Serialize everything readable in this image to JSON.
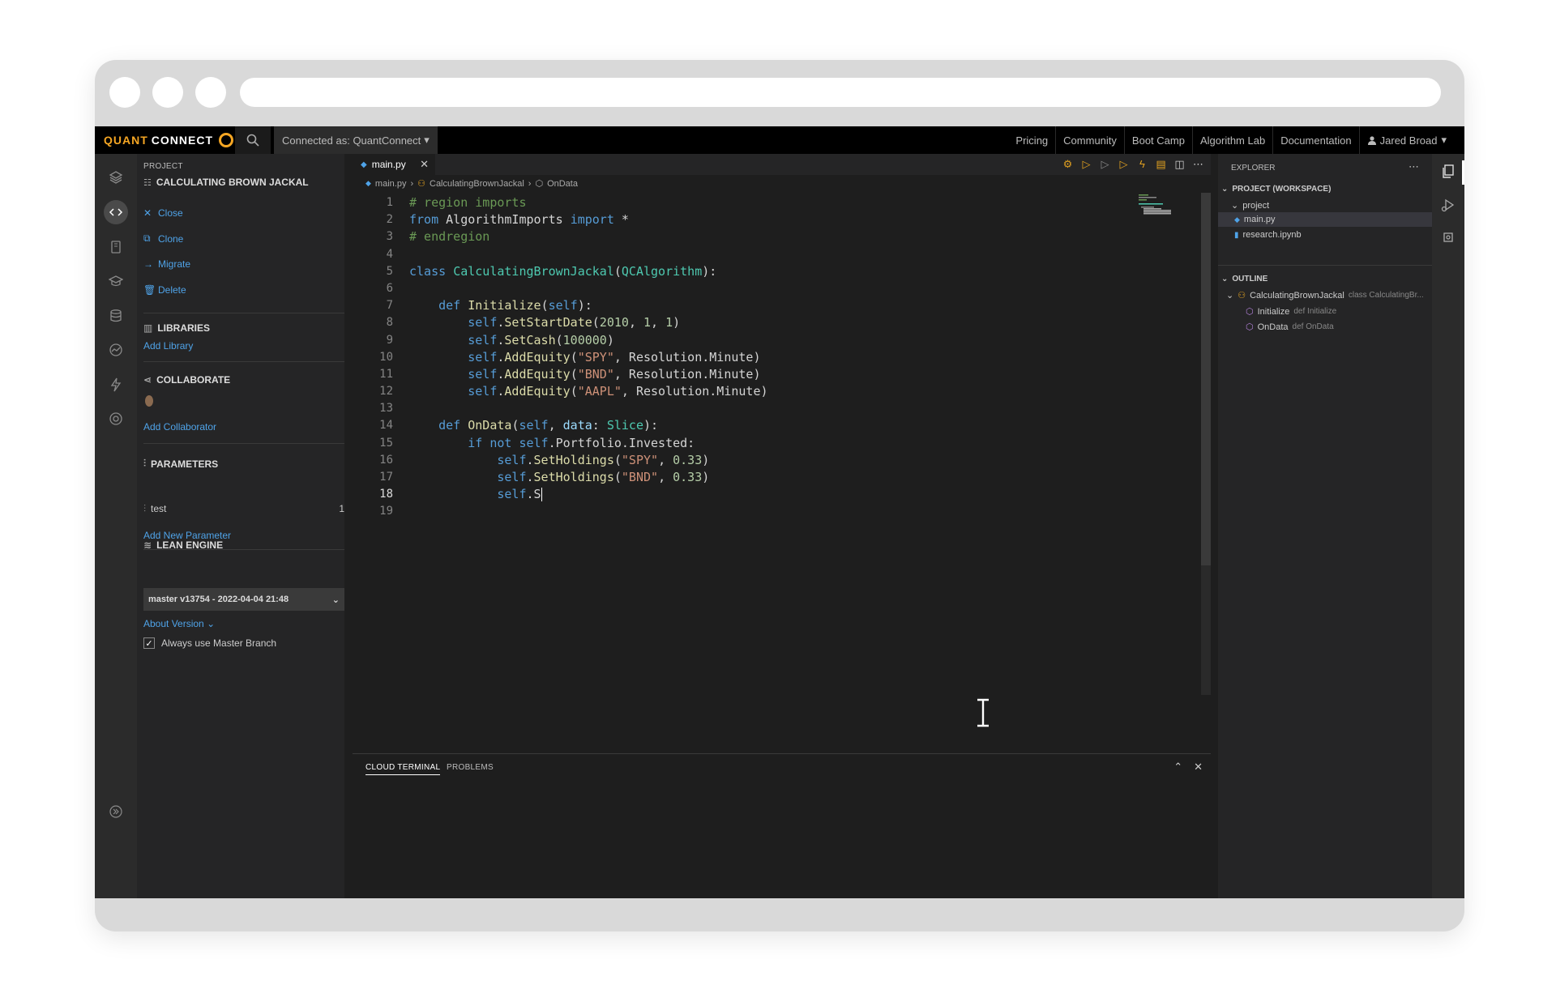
{
  "topnav": {
    "logo_primary": "QUANT",
    "logo_secondary": "CONNECT",
    "connected": "Connected as: QuantConnect",
    "links": [
      "Pricing",
      "Community",
      "Boot Camp",
      "Algorithm Lab",
      "Documentation"
    ],
    "user": "Jared Broad"
  },
  "project": {
    "section_title": "PROJECT",
    "name": "CALCULATING BROWN JACKAL",
    "actions": [
      "Close",
      "Clone",
      "Migrate",
      "Delete"
    ],
    "libraries": {
      "title": "LIBRARIES",
      "add": "Add Library"
    },
    "collaborate": {
      "title": "COLLABORATE",
      "add": "Add Collaborator"
    },
    "parameters": {
      "title": "PARAMETERS",
      "name": "test",
      "value": "1",
      "add": "Add New Parameter"
    },
    "lean": {
      "title": "LEAN ENGINE",
      "version": "master v13754 - 2022-04-04 21:48",
      "about": "About Version",
      "checkbox_label": "Always use Master Branch",
      "checkbox_checked": true
    }
  },
  "editor": {
    "tab": "main.py",
    "breadcrumb": [
      "main.py",
      "CalculatingBrownJackal",
      "OnData"
    ],
    "current_line": 18,
    "lines": [
      "# region imports",
      "from AlgorithmImports import *",
      "# endregion",
      "",
      "class CalculatingBrownJackal(QCAlgorithm):",
      "",
      "    def Initialize(self):",
      "        self.SetStartDate(2010, 1, 1)",
      "        self.SetCash(100000)",
      "        self.AddEquity(\"SPY\", Resolution.Minute)",
      "        self.AddEquity(\"BND\", Resolution.Minute)",
      "        self.AddEquity(\"AAPL\", Resolution.Minute)",
      "",
      "    def OnData(self, data: Slice):",
      "        if not self.Portfolio.Invested:",
      "            self.SetHoldings(\"SPY\", 0.33)",
      "            self.SetHoldings(\"BND\", 0.33)",
      "            self.S",
      ""
    ]
  },
  "terminal": {
    "tabs": [
      "CLOUD TERMINAL",
      "PROBLEMS"
    ]
  },
  "explorer": {
    "title": "EXPLORER",
    "workspace": "PROJECT (WORKSPACE)",
    "folder": "project",
    "files": [
      "main.py",
      "research.ipynb"
    ],
    "outline_title": "OUTLINE",
    "outline": [
      {
        "name": "CalculatingBrownJackal",
        "detail": "class CalculatingBr..."
      },
      {
        "name": "Initialize",
        "detail": "def Initialize"
      },
      {
        "name": "OnData",
        "detail": "def OnData"
      }
    ]
  },
  "colors": {
    "accent": "#f5a623",
    "link": "#4fa3e8",
    "editor_bg": "#1e1e1e"
  }
}
